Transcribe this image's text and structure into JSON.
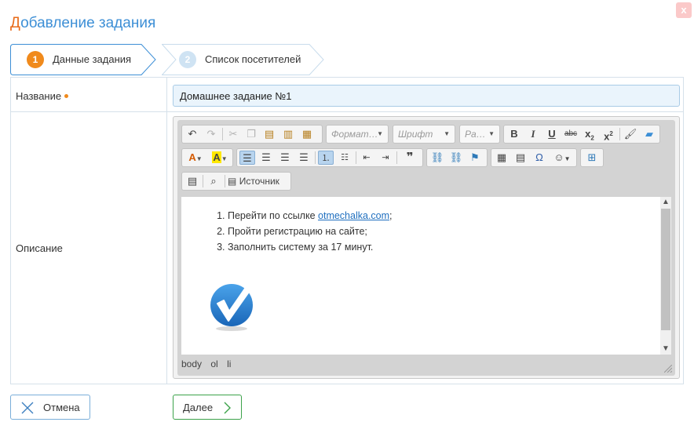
{
  "dialog": {
    "title_first_letter": "Д",
    "title_rest": "обавление задания",
    "close_label": "x"
  },
  "steps": [
    {
      "number": "1",
      "label": "Данные задания",
      "active": true
    },
    {
      "number": "2",
      "label": "Список посетителей",
      "active": false
    }
  ],
  "form": {
    "name_label": "Название",
    "name_value": "Домашнее задание №1",
    "description_label": "Описание"
  },
  "editor": {
    "toolbar": {
      "format_combo": "Формат…",
      "font_combo": "Шрифт",
      "size_combo": "Ра…",
      "source_label": "Источник"
    },
    "content": {
      "item1_prefix": "Перейти по ссылке ",
      "item1_link": "otmechalka.com",
      "item1_suffix": ";",
      "item2": "Пройти регистрацию на сайте;",
      "item3": "Заполнить систему за 17 минут."
    },
    "path": [
      "body",
      "ol",
      "li"
    ]
  },
  "actions": {
    "cancel_label": "Отмена",
    "next_label": "Далее"
  },
  "colors": {
    "accent_blue": "#3d8fd6",
    "accent_orange": "#e86b1a",
    "step_active": "#f08a1c",
    "next_green": "#3ca24a"
  }
}
